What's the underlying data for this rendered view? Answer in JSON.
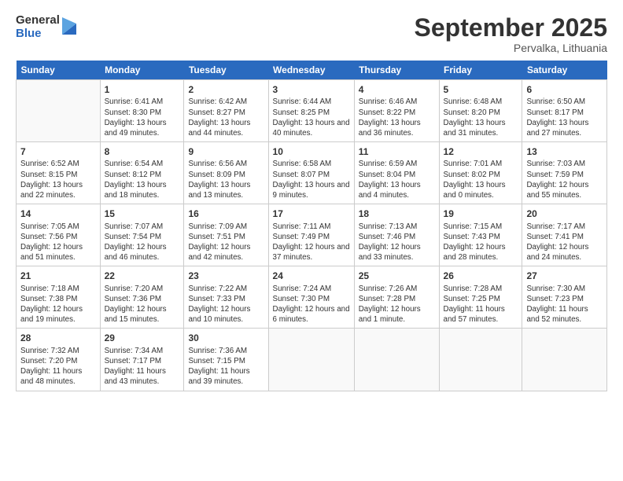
{
  "logo": {
    "general": "General",
    "blue": "Blue"
  },
  "title": "September 2025",
  "location": "Pervalka, Lithuania",
  "days_of_week": [
    "Sunday",
    "Monday",
    "Tuesday",
    "Wednesday",
    "Thursday",
    "Friday",
    "Saturday"
  ],
  "weeks": [
    [
      {
        "num": "",
        "sunrise": "",
        "sunset": "",
        "daylight": ""
      },
      {
        "num": "1",
        "sunrise": "Sunrise: 6:41 AM",
        "sunset": "Sunset: 8:30 PM",
        "daylight": "Daylight: 13 hours and 49 minutes."
      },
      {
        "num": "2",
        "sunrise": "Sunrise: 6:42 AM",
        "sunset": "Sunset: 8:27 PM",
        "daylight": "Daylight: 13 hours and 44 minutes."
      },
      {
        "num": "3",
        "sunrise": "Sunrise: 6:44 AM",
        "sunset": "Sunset: 8:25 PM",
        "daylight": "Daylight: 13 hours and 40 minutes."
      },
      {
        "num": "4",
        "sunrise": "Sunrise: 6:46 AM",
        "sunset": "Sunset: 8:22 PM",
        "daylight": "Daylight: 13 hours and 36 minutes."
      },
      {
        "num": "5",
        "sunrise": "Sunrise: 6:48 AM",
        "sunset": "Sunset: 8:20 PM",
        "daylight": "Daylight: 13 hours and 31 minutes."
      },
      {
        "num": "6",
        "sunrise": "Sunrise: 6:50 AM",
        "sunset": "Sunset: 8:17 PM",
        "daylight": "Daylight: 13 hours and 27 minutes."
      }
    ],
    [
      {
        "num": "7",
        "sunrise": "Sunrise: 6:52 AM",
        "sunset": "Sunset: 8:15 PM",
        "daylight": "Daylight: 13 hours and 22 minutes."
      },
      {
        "num": "8",
        "sunrise": "Sunrise: 6:54 AM",
        "sunset": "Sunset: 8:12 PM",
        "daylight": "Daylight: 13 hours and 18 minutes."
      },
      {
        "num": "9",
        "sunrise": "Sunrise: 6:56 AM",
        "sunset": "Sunset: 8:09 PM",
        "daylight": "Daylight: 13 hours and 13 minutes."
      },
      {
        "num": "10",
        "sunrise": "Sunrise: 6:58 AM",
        "sunset": "Sunset: 8:07 PM",
        "daylight": "Daylight: 13 hours and 9 minutes."
      },
      {
        "num": "11",
        "sunrise": "Sunrise: 6:59 AM",
        "sunset": "Sunset: 8:04 PM",
        "daylight": "Daylight: 13 hours and 4 minutes."
      },
      {
        "num": "12",
        "sunrise": "Sunrise: 7:01 AM",
        "sunset": "Sunset: 8:02 PM",
        "daylight": "Daylight: 13 hours and 0 minutes."
      },
      {
        "num": "13",
        "sunrise": "Sunrise: 7:03 AM",
        "sunset": "Sunset: 7:59 PM",
        "daylight": "Daylight: 12 hours and 55 minutes."
      }
    ],
    [
      {
        "num": "14",
        "sunrise": "Sunrise: 7:05 AM",
        "sunset": "Sunset: 7:56 PM",
        "daylight": "Daylight: 12 hours and 51 minutes."
      },
      {
        "num": "15",
        "sunrise": "Sunrise: 7:07 AM",
        "sunset": "Sunset: 7:54 PM",
        "daylight": "Daylight: 12 hours and 46 minutes."
      },
      {
        "num": "16",
        "sunrise": "Sunrise: 7:09 AM",
        "sunset": "Sunset: 7:51 PM",
        "daylight": "Daylight: 12 hours and 42 minutes."
      },
      {
        "num": "17",
        "sunrise": "Sunrise: 7:11 AM",
        "sunset": "Sunset: 7:49 PM",
        "daylight": "Daylight: 12 hours and 37 minutes."
      },
      {
        "num": "18",
        "sunrise": "Sunrise: 7:13 AM",
        "sunset": "Sunset: 7:46 PM",
        "daylight": "Daylight: 12 hours and 33 minutes."
      },
      {
        "num": "19",
        "sunrise": "Sunrise: 7:15 AM",
        "sunset": "Sunset: 7:43 PM",
        "daylight": "Daylight: 12 hours and 28 minutes."
      },
      {
        "num": "20",
        "sunrise": "Sunrise: 7:17 AM",
        "sunset": "Sunset: 7:41 PM",
        "daylight": "Daylight: 12 hours and 24 minutes."
      }
    ],
    [
      {
        "num": "21",
        "sunrise": "Sunrise: 7:18 AM",
        "sunset": "Sunset: 7:38 PM",
        "daylight": "Daylight: 12 hours and 19 minutes."
      },
      {
        "num": "22",
        "sunrise": "Sunrise: 7:20 AM",
        "sunset": "Sunset: 7:36 PM",
        "daylight": "Daylight: 12 hours and 15 minutes."
      },
      {
        "num": "23",
        "sunrise": "Sunrise: 7:22 AM",
        "sunset": "Sunset: 7:33 PM",
        "daylight": "Daylight: 12 hours and 10 minutes."
      },
      {
        "num": "24",
        "sunrise": "Sunrise: 7:24 AM",
        "sunset": "Sunset: 7:30 PM",
        "daylight": "Daylight: 12 hours and 6 minutes."
      },
      {
        "num": "25",
        "sunrise": "Sunrise: 7:26 AM",
        "sunset": "Sunset: 7:28 PM",
        "daylight": "Daylight: 12 hours and 1 minute."
      },
      {
        "num": "26",
        "sunrise": "Sunrise: 7:28 AM",
        "sunset": "Sunset: 7:25 PM",
        "daylight": "Daylight: 11 hours and 57 minutes."
      },
      {
        "num": "27",
        "sunrise": "Sunrise: 7:30 AM",
        "sunset": "Sunset: 7:23 PM",
        "daylight": "Daylight: 11 hours and 52 minutes."
      }
    ],
    [
      {
        "num": "28",
        "sunrise": "Sunrise: 7:32 AM",
        "sunset": "Sunset: 7:20 PM",
        "daylight": "Daylight: 11 hours and 48 minutes."
      },
      {
        "num": "29",
        "sunrise": "Sunrise: 7:34 AM",
        "sunset": "Sunset: 7:17 PM",
        "daylight": "Daylight: 11 hours and 43 minutes."
      },
      {
        "num": "30",
        "sunrise": "Sunrise: 7:36 AM",
        "sunset": "Sunset: 7:15 PM",
        "daylight": "Daylight: 11 hours and 39 minutes."
      },
      {
        "num": "",
        "sunrise": "",
        "sunset": "",
        "daylight": ""
      },
      {
        "num": "",
        "sunrise": "",
        "sunset": "",
        "daylight": ""
      },
      {
        "num": "",
        "sunrise": "",
        "sunset": "",
        "daylight": ""
      },
      {
        "num": "",
        "sunrise": "",
        "sunset": "",
        "daylight": ""
      }
    ]
  ]
}
